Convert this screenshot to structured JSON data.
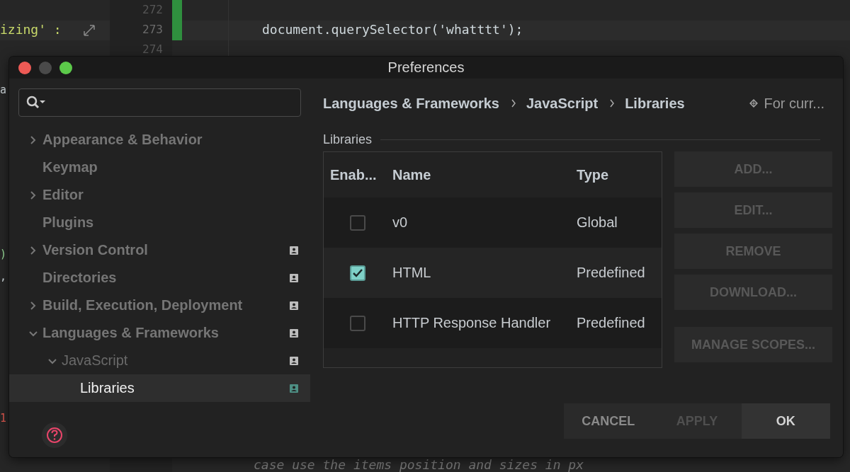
{
  "editor": {
    "gutter": [
      {
        "number": "272",
        "current": false
      },
      {
        "number": "273",
        "current": true
      },
      {
        "number": "274",
        "current": false
      }
    ],
    "fragments": [
      {
        "kind": "key",
        "text": "izing' :"
      },
      {
        "kind": "code",
        "text": "document.querySelector('whatttt');"
      },
      {
        "kind": "edge",
        "text": "a"
      },
      {
        "kind": "bracket",
        "text": ")"
      },
      {
        "kind": "edge",
        "text": ","
      },
      {
        "kind": "number",
        "text": "1"
      },
      {
        "kind": "comment",
        "text": "case use the items position and sizes in px"
      }
    ]
  },
  "window": {
    "title": "Preferences"
  },
  "sidebar": {
    "items": [
      {
        "label": "Appearance & Behavior",
        "expanded": false,
        "project_scoped": false,
        "selected": false
      },
      {
        "label": "Keymap",
        "project_scoped": false,
        "selected": false
      },
      {
        "label": "Editor",
        "expanded": false,
        "project_scoped": false,
        "selected": false
      },
      {
        "label": "Plugins",
        "project_scoped": false,
        "selected": false
      },
      {
        "label": "Version Control",
        "expanded": false,
        "project_scoped": true,
        "selected": false
      },
      {
        "label": "Directories",
        "project_scoped": true,
        "selected": false
      },
      {
        "label": "Build, Execution, Deployment",
        "expanded": false,
        "project_scoped": true,
        "selected": false
      },
      {
        "label": "Languages & Frameworks",
        "expanded": true,
        "project_scoped": true,
        "selected": false,
        "children": [
          {
            "label": "JavaScript",
            "expanded": true,
            "project_scoped": true,
            "selected": false,
            "children": [
              {
                "label": "Libraries",
                "project_scoped": true,
                "selected": true
              }
            ]
          }
        ]
      }
    ]
  },
  "breadcrumb": [
    "Languages & Frameworks",
    "JavaScript",
    "Libraries"
  ],
  "scope_note": "For curr...",
  "section_title": "Libraries",
  "table": {
    "columns": [
      "Enab...",
      "Name",
      "Type"
    ],
    "rows": [
      {
        "enabled": false,
        "name": "v0",
        "type": "Global"
      },
      {
        "enabled": true,
        "name": "HTML",
        "type": "Predefined"
      },
      {
        "enabled": false,
        "name": "HTTP Response Handler",
        "type": "Predefined"
      }
    ]
  },
  "side_buttons": [
    {
      "label": "ADD...",
      "disabled": true
    },
    {
      "label": "EDIT...",
      "disabled": true
    },
    {
      "label": "REMOVE",
      "disabled": true
    },
    {
      "label": "DOWNLOAD...",
      "disabled": true
    },
    {
      "label": "MANAGE SCOPES...",
      "disabled": true
    }
  ],
  "footer_buttons": [
    {
      "label": "CANCEL",
      "disabled": false,
      "default": false
    },
    {
      "label": "APPLY",
      "disabled": true,
      "default": false
    },
    {
      "label": "OK",
      "disabled": false,
      "default": true
    }
  ]
}
